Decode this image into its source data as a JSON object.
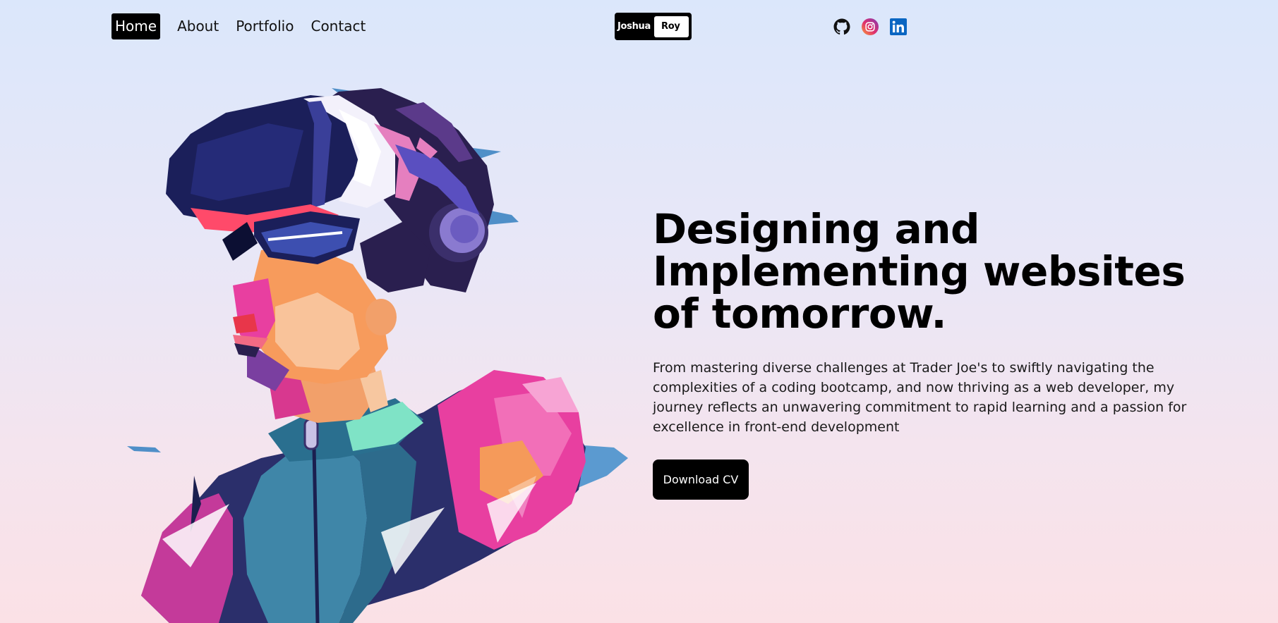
{
  "nav": {
    "items": [
      {
        "label": "Home",
        "active": true
      },
      {
        "label": "About",
        "active": false
      },
      {
        "label": "Portfolio",
        "active": false
      },
      {
        "label": "Contact",
        "active": false
      }
    ]
  },
  "logo": {
    "first": "Joshua",
    "last": "Roy"
  },
  "socials": [
    {
      "icon": "github-icon"
    },
    {
      "icon": "instagram-icon"
    },
    {
      "icon": "linkedin-icon"
    }
  ],
  "hero": {
    "title": "Designing and Implementing websites of tomorrow.",
    "description": "From mastering diverse challenges at Trader Joe's to swiftly navigating the complexities of a coding bootcamp, and now thriving as a web developer, my journey reflects an unwavering commitment to rapid learning and a passion for excellence in front-end development",
    "cta_label": "Download CV",
    "illustration": "vr-headset-person-illustration"
  },
  "colors": {
    "background_top": "#dbe7fb",
    "background_bottom": "#fbe1e6",
    "accent": "#000000",
    "illustration_pink": "#e83fa0",
    "illustration_navy": "#1b1f4f",
    "illustration_teal": "#3f86a8"
  }
}
